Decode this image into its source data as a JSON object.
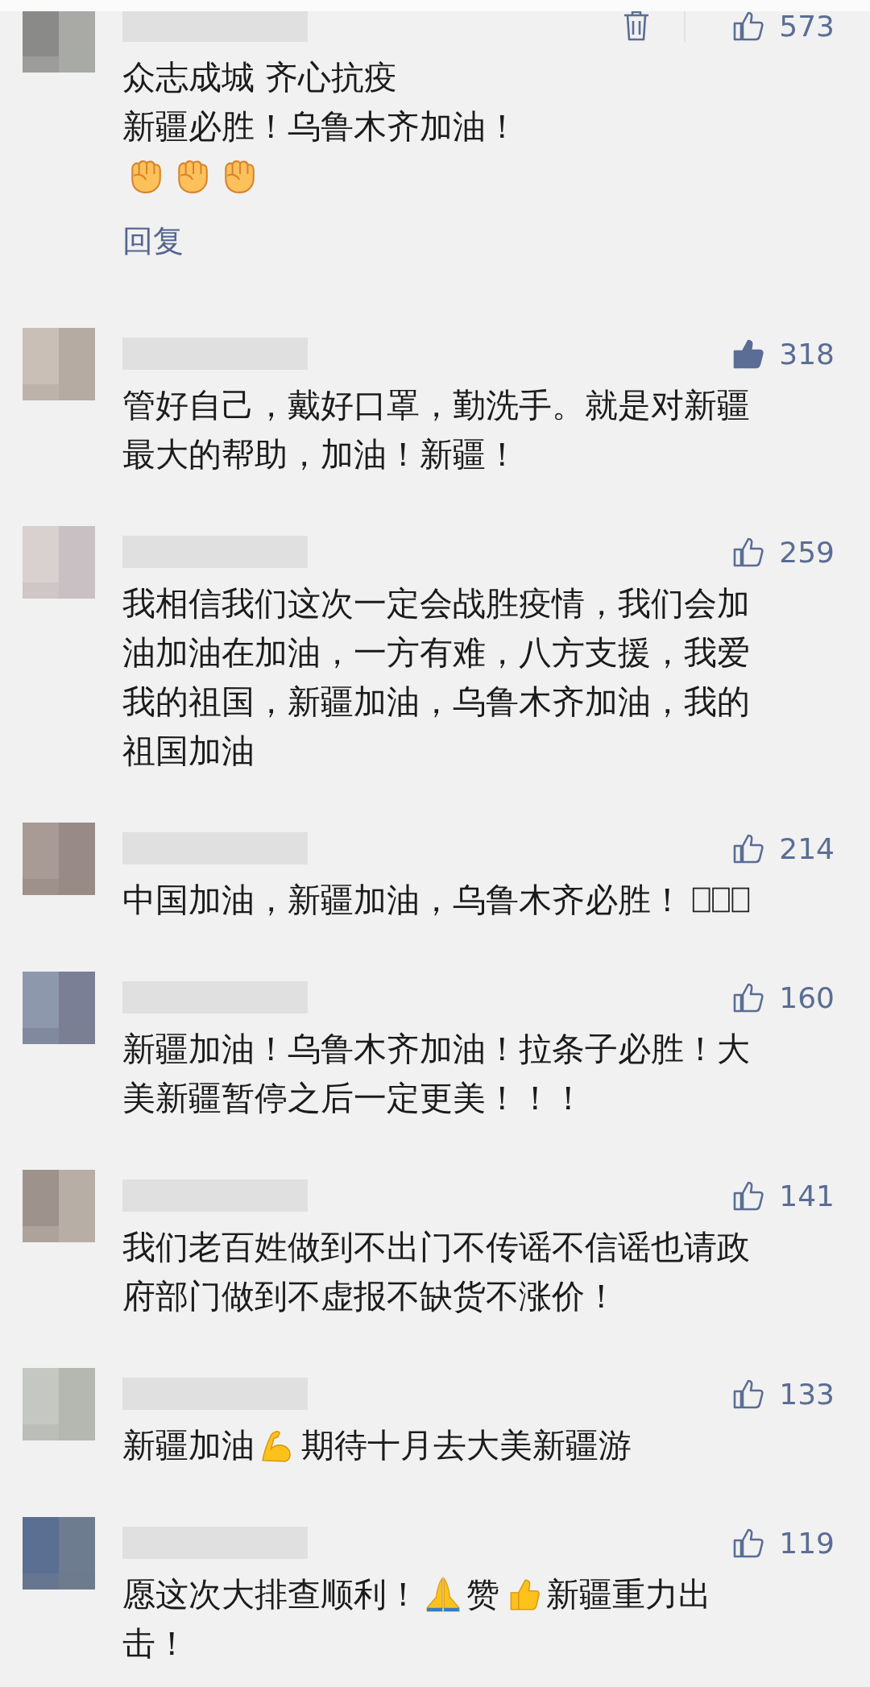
{
  "comments": [
    {
      "likes": "573",
      "liked": false,
      "deletable": true,
      "lines": [
        [
          {
            "kind": "text",
            "text": "众志成城 齐心抗疫"
          }
        ],
        [
          {
            "kind": "text",
            "text": "新疆必胜！乌鲁木齐加油！"
          }
        ],
        [
          {
            "kind": "fist"
          },
          {
            "kind": "fist"
          },
          {
            "kind": "fist"
          }
        ]
      ],
      "reply": "回复"
    },
    {
      "likes": "318",
      "liked": true,
      "deletable": false,
      "lines": [
        [
          {
            "kind": "text",
            "text": "管好自己，戴好口罩，勤洗手。就是对新疆最大的帮助，加油！新疆！"
          }
        ]
      ]
    },
    {
      "likes": "259",
      "liked": false,
      "deletable": false,
      "lines": [
        [
          {
            "kind": "text",
            "text": "我相信我们这次一定会战胜疫情，我们会加油加油在加油，一方有难，八方支援，我爱我的祖国，新疆加油，乌鲁木齐加油，我的祖国加油"
          }
        ]
      ]
    },
    {
      "likes": "214",
      "liked": false,
      "deletable": false,
      "lines": [
        [
          {
            "kind": "text",
            "text": "中国加油，新疆加油，乌鲁木齐必胜！"
          },
          {
            "kind": "missing"
          }
        ]
      ]
    },
    {
      "likes": "160",
      "liked": false,
      "deletable": false,
      "lines": [
        [
          {
            "kind": "text",
            "text": "新疆加油！乌鲁木齐加油！拉条子必胜！大美新疆暂停之后一定更美！！！"
          }
        ]
      ]
    },
    {
      "likes": "141",
      "liked": false,
      "deletable": false,
      "lines": [
        [
          {
            "kind": "text",
            "text": "我们老百姓做到不出门不传谣不信谣也请政府部门做到不虚报不缺货不涨价！"
          }
        ]
      ]
    },
    {
      "likes": "133",
      "liked": false,
      "deletable": false,
      "lines": [
        [
          {
            "kind": "text",
            "text": "新疆加油"
          },
          {
            "kind": "muscle"
          },
          {
            "kind": "text",
            "text": "期待十月去大美新疆游"
          }
        ]
      ]
    },
    {
      "likes": "119",
      "liked": false,
      "deletable": false,
      "lines": [
        [
          {
            "kind": "text",
            "text": "愿这次大排查顺利！"
          },
          {
            "kind": "pray"
          },
          {
            "kind": "text",
            "text": "赞"
          },
          {
            "kind": "thumb"
          },
          {
            "kind": "text",
            "text": "新疆重力出"
          }
        ],
        [
          {
            "kind": "text",
            "text": "击！"
          }
        ]
      ]
    }
  ]
}
